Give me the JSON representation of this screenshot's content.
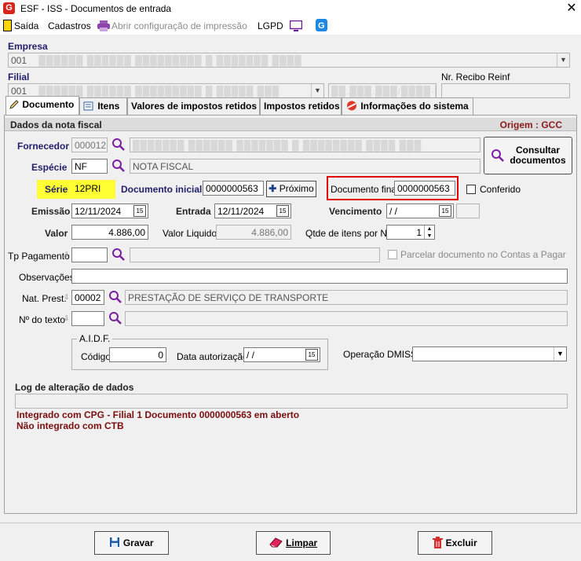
{
  "window": {
    "title": "ESF - ISS - Documentos de entrada",
    "close": "✕"
  },
  "menu": {
    "exit": "Saída",
    "registrations": "Cadastros",
    "print_config": "Abrir configuração de impressão",
    "lgpd": "LGPD"
  },
  "header": {
    "company_label": "Empresa",
    "company_value": "001",
    "company_redacted": "██████ ██████ █████████ █ ███████ ████",
    "branch_label": "Filial",
    "branch_value": "001",
    "branch_redacted": "██████ ██████ █████████ █ █████ ███",
    "branch_cnpj_redacted": "██.███.███/████-██",
    "reinf_label": "Nr. Recibo Reinf",
    "reinf_value": ""
  },
  "tabs": [
    {
      "label": "Documento"
    },
    {
      "label": "Itens"
    },
    {
      "label": "Valores de impostos retidos"
    },
    {
      "label": "Impostos retidos"
    },
    {
      "label": "Informações do sistema"
    }
  ],
  "section": {
    "title": "Dados da nota fiscal",
    "origin": "Origem : GCC"
  },
  "form": {
    "supplier_label": "Fornecedor",
    "supplier_code": "000012",
    "supplier_name_redacted": "███████ ██████ ███████ █ ████████ ████ ███",
    "consult_button": "Consultar documentos",
    "species_label": "Espécie",
    "species_code": "NF",
    "species_name": "NOTA FISCAL",
    "series_label": "Série",
    "series_value": "12PRI",
    "initial_doc_label": "Documento inicial",
    "initial_doc_value": "0000000563",
    "next_button": "Próximo",
    "final_doc_label": "Documento final",
    "final_doc_value": "0000000563",
    "checked_label": "Conferido",
    "issue_label": "Emissão",
    "issue_value": "12/11/2024",
    "entry_label": "Entrada",
    "entry_value": "12/11/2024",
    "due_label": "Vencimento",
    "due_value": " /  /",
    "value_label": "Valor",
    "value_value": "4.886,00",
    "net_value_label": "Valor Liquido",
    "net_value_value": "4.886,00",
    "items_qty_label": "Qtde de itens por NF",
    "items_qty_value": "1",
    "payment_type_label": "Tp Pagamento",
    "installments_label": "Parcelar documento no Contas a Pagar",
    "notes_label": "Observações",
    "service_nature_label": "Nat. Prest.",
    "service_nature_code": "00002",
    "service_nature_name": "PRESTAÇÃO DE SERVIÇO DE TRANSPORTE",
    "text_no_label": "Nº do texto",
    "aidf_title": "A.I.D.F.",
    "aidf_code_label": "Código",
    "aidf_code_value": "0",
    "aidf_date_label": "Data autorização",
    "aidf_date_value": " /  /",
    "dmiss_label": "Operação DMISS",
    "log_label": "Log de alteração de dados",
    "log_line1": "Integrado com CPG - Filial 1 Documento 0000000563 em aberto",
    "log_line2": "Não integrado com CTB"
  },
  "footer": {
    "save": "Gravar",
    "clear": "Limpar",
    "delete": "Excluir"
  },
  "colors": {
    "label_blue": "#1f1f6b",
    "highlight_yellow": "#ffff33",
    "highlight_red": "#e00000",
    "log_maroon": "#7a0d0d"
  }
}
